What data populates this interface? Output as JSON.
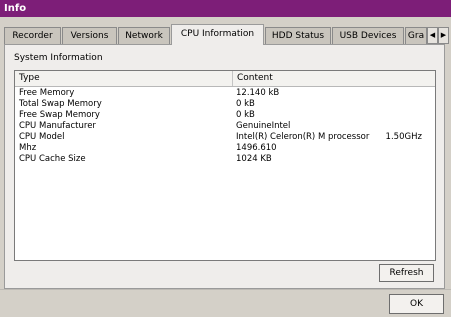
{
  "window": {
    "title": "Info"
  },
  "tabs": [
    {
      "label": "Recorder"
    },
    {
      "label": "Versions"
    },
    {
      "label": "Network"
    },
    {
      "label": "CPU Information",
      "active": true
    },
    {
      "label": "HDD Status"
    },
    {
      "label": "USB Devices"
    },
    {
      "label": "Gra"
    }
  ],
  "tab_scroll": {
    "left_icon": "chevron-left-icon",
    "right_icon": "chevron-right-icon"
  },
  "section": {
    "label": "System Information"
  },
  "table": {
    "columns": [
      "Type",
      "Content"
    ],
    "rows": [
      {
        "type": "Free Memory",
        "content": "12.140 kB"
      },
      {
        "type": "Total Swap Memory",
        "content": "0 kB"
      },
      {
        "type": "Free Swap Memory",
        "content": "0 kB"
      },
      {
        "type": "CPU Manufacturer",
        "content": "GenuineIntel"
      },
      {
        "type": "CPU Model",
        "content": "Intel(R) Celeron(R) M processor      1.50GHz"
      },
      {
        "type": "Mhz",
        "content": "1496.610"
      },
      {
        "type": "CPU Cache Size",
        "content": "1024 KB"
      }
    ]
  },
  "buttons": {
    "refresh": "Refresh",
    "ok": "OK"
  },
  "colors": {
    "titlebar": "#7d1e78",
    "dialog": "#d4d0c8"
  }
}
